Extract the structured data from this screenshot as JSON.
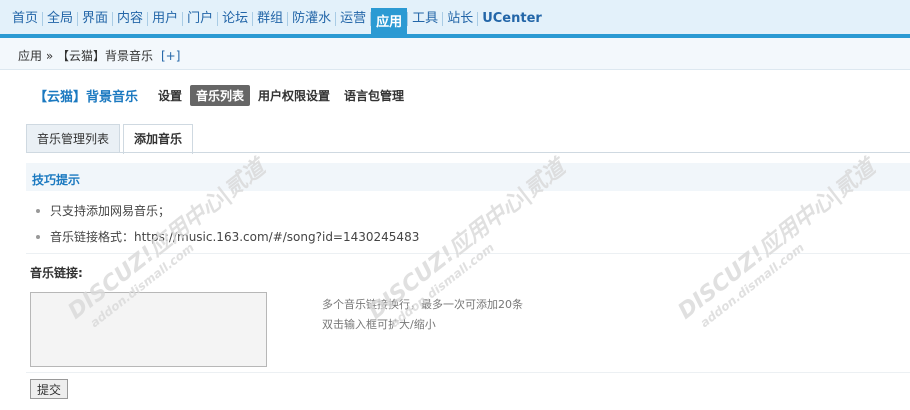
{
  "topnav": {
    "items": [
      {
        "label": "首页"
      },
      {
        "label": "全局"
      },
      {
        "label": "界面"
      },
      {
        "label": "内容"
      },
      {
        "label": "用户"
      },
      {
        "label": "门户"
      },
      {
        "label": "论坛"
      },
      {
        "label": "群组"
      },
      {
        "label": "防灌水"
      },
      {
        "label": "运营"
      },
      {
        "label": "应用",
        "active": true
      },
      {
        "label": "工具"
      },
      {
        "label": "站长"
      },
      {
        "label": "UCenter",
        "bold": true
      }
    ]
  },
  "breadcrumb": {
    "text": "应用 » 【云猫】背景音乐",
    "plus": "[+]"
  },
  "plugin": {
    "title": "【云猫】背景音乐",
    "nav": [
      {
        "label": "设置"
      },
      {
        "label": "音乐列表",
        "active": true
      },
      {
        "label": "用户权限设置"
      },
      {
        "label": "语言包管理"
      }
    ]
  },
  "tabs": [
    {
      "label": "音乐管理列表"
    },
    {
      "label": "添加音乐",
      "active": true
    }
  ],
  "tips": {
    "title": "技巧提示",
    "items": [
      "只支持添加网易音乐；",
      "音乐链接格式：https://music.163.com/#/song?id=1430245483"
    ]
  },
  "form": {
    "label": "音乐链接:",
    "value": "",
    "hints": [
      "多个音乐链接换行，最多一次可添加20条",
      "双击输入框可扩大/缩小"
    ],
    "submit_label": "提交"
  },
  "watermark": {
    "line1": "DISCUZ!应用中心|贰道",
    "line2": "addon.dismall.com"
  },
  "colors": {
    "nav_accent": "#2b9ad3",
    "link": "#1b79c0"
  }
}
